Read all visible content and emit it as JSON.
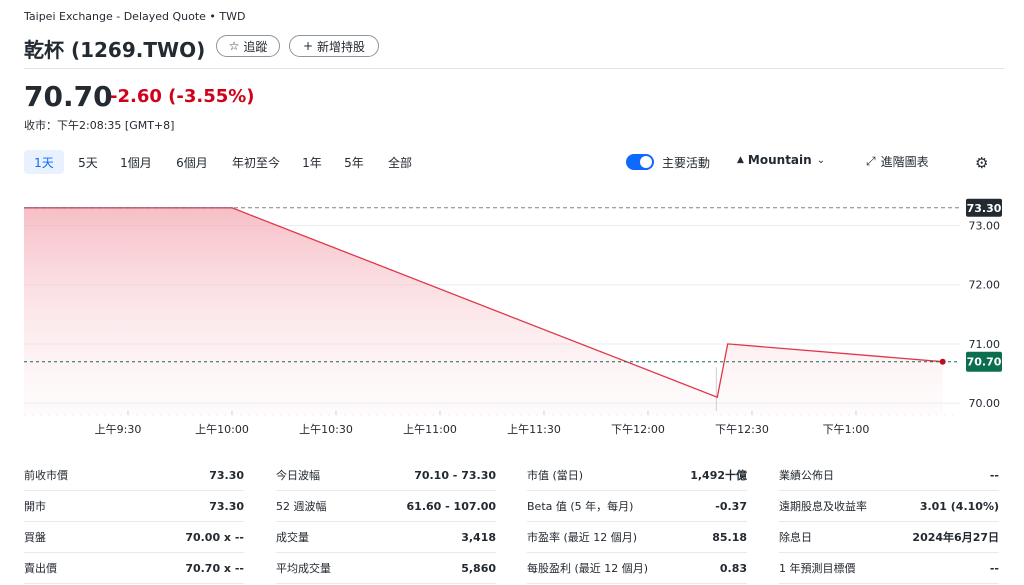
{
  "header": {
    "exchange": "Taipei Exchange - Delayed Quote • TWD",
    "title": "乾杯 (1269.TWO)",
    "follow_label": "追蹤",
    "add_holding_label": "新增持股"
  },
  "quote": {
    "price": "70.70",
    "change": "-2.60 (-3.55%)",
    "close_time": "收市：下午2:08:35 [GMT+8]"
  },
  "ranges": [
    "1天",
    "5天",
    "1個月",
    "6個月",
    "年初至今",
    "1年",
    "5年",
    "全部"
  ],
  "active_range": "1天",
  "controls": {
    "key_events": "主要活動",
    "chart_type": "Mountain",
    "advanced_chart": "進階圖表",
    "icons": [
      "star-icon",
      "plus-icon",
      "mountain-icon",
      "chevron-down-icon",
      "expand-icon",
      "gear-icon"
    ]
  },
  "colors": {
    "accent": "#0f69ff",
    "negative": "#d0021b",
    "prev_close_label_bg": "#232a31",
    "current_label_bg": "#0b6e4f"
  },
  "chart_data": {
    "type": "area",
    "x": [
      "09:00",
      "10:00",
      "12:20",
      "12:23",
      "13:25"
    ],
    "values": [
      73.3,
      73.3,
      70.1,
      71.0,
      70.7
    ],
    "xticks": [
      "上午9:30",
      "上午10:00",
      "上午10:30",
      "上午11:00",
      "上午11:30",
      "下午12:00",
      "下午12:30",
      "下午1:00"
    ],
    "yticks": [
      "73.00",
      "72.00",
      "71.00",
      "70.00"
    ],
    "ylim": [
      69.8,
      73.6
    ],
    "previous_close": "73.30",
    "current": "70.70",
    "grid": true
  },
  "stats": {
    "col1": [
      {
        "label": "前收市價",
        "value": "73.30"
      },
      {
        "label": "開市",
        "value": "73.30"
      },
      {
        "label": "買盤",
        "value": "70.00 x --"
      },
      {
        "label": "賣出價",
        "value": "70.70 x --"
      }
    ],
    "col2": [
      {
        "label": "今日波幅",
        "value": "70.10 - 73.30"
      },
      {
        "label": "52 週波幅",
        "value": "61.60 - 107.00"
      },
      {
        "label": "成交量",
        "value": "3,418"
      },
      {
        "label": "平均成交量",
        "value": "5,860"
      }
    ],
    "col3": [
      {
        "label": "市值 (當日)",
        "value": "1,492十億"
      },
      {
        "label": "Beta 值 (5 年，每月)",
        "value": "-0.37"
      },
      {
        "label": "市盈率 (最近 12 個月)",
        "value": "85.18"
      },
      {
        "label": "每股盈利 (最近 12 個月)",
        "value": "0.83"
      }
    ],
    "col4": [
      {
        "label": "業績公佈日",
        "value": "--"
      },
      {
        "label": "遠期股息及收益率",
        "value": "3.01 (4.10%)"
      },
      {
        "label": "除息日",
        "value": "2024年6月27日"
      },
      {
        "label": "1 年預測目標價",
        "value": "--"
      }
    ]
  }
}
